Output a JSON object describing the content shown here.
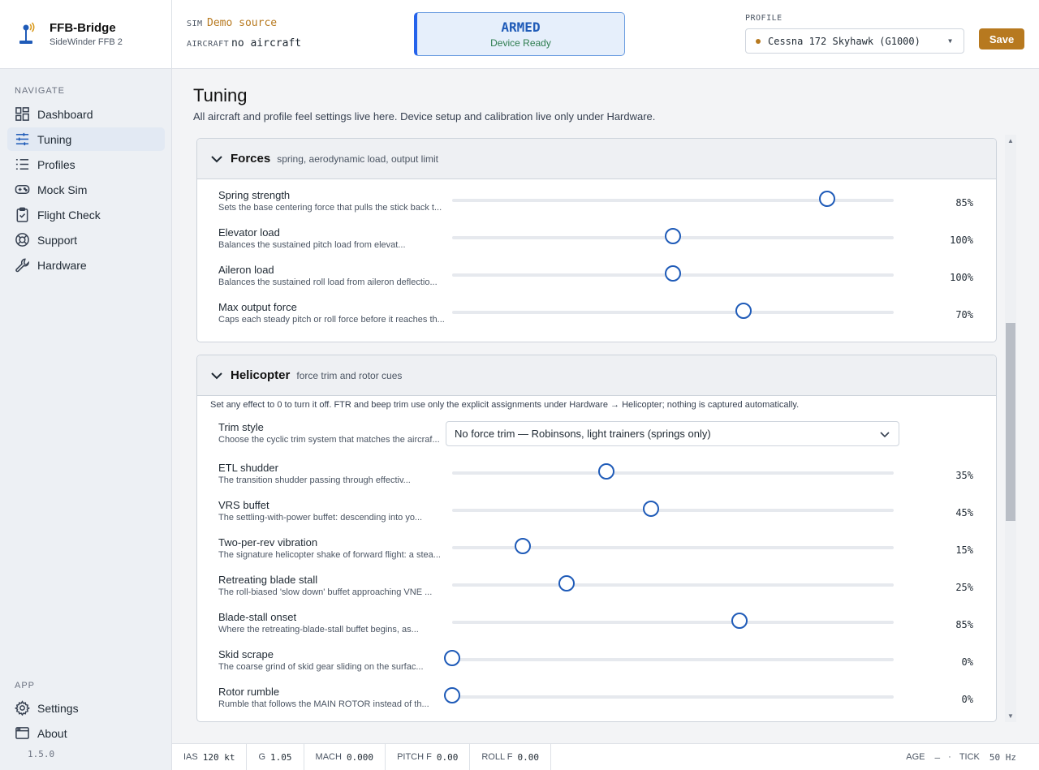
{
  "brand": {
    "title": "FFB-Bridge",
    "subtitle": "SideWinder FFB 2"
  },
  "nav": {
    "heading": "NAVIGATE",
    "items": [
      {
        "label": "Dashboard",
        "icon": "dashboard-icon"
      },
      {
        "label": "Tuning",
        "icon": "sliders-icon",
        "active": true
      },
      {
        "label": "Profiles",
        "icon": "list-icon"
      },
      {
        "label": "Mock Sim",
        "icon": "gamepad-icon"
      },
      {
        "label": "Flight Check",
        "icon": "clipboard-check-icon"
      },
      {
        "label": "Support",
        "icon": "lifebuoy-icon"
      },
      {
        "label": "Hardware",
        "icon": "wrench-icon"
      }
    ],
    "app_heading": "APP",
    "app_items": [
      {
        "label": "Settings",
        "icon": "gear-icon"
      },
      {
        "label": "About",
        "icon": "window-icon"
      }
    ],
    "version": "1.5.0"
  },
  "header": {
    "sim_label": "SIM",
    "sim_value": "Demo source",
    "aircraft_label": "AIRCRAFT",
    "aircraft_value": "no aircraft",
    "status_title": "ARMED",
    "status_sub": "Device Ready",
    "profile_label": "PROFILE",
    "profile_value": "Cessna 172 Skyhawk (G1000)",
    "save_label": "Save"
  },
  "page": {
    "title": "Tuning",
    "subtitle": "All aircraft and profile feel settings live here. Device setup and calibration live only under Hardware."
  },
  "forces": {
    "title": "Forces",
    "desc": "spring, aerodynamic load, output limit",
    "rows": [
      {
        "label": "Spring strength",
        "desc": "Sets the base centering force that pulls the stick back t...",
        "value": 85,
        "display": "85%"
      },
      {
        "label": "Elevator load",
        "desc": "Balances the sustained pitch load from elevat...",
        "value": 50,
        "display": "100%"
      },
      {
        "label": "Aileron load",
        "desc": "Balances the sustained roll load from aileron deflectio...",
        "value": 50,
        "display": "100%"
      },
      {
        "label": "Max output force",
        "desc": "Caps each steady pitch or roll force before it reaches th...",
        "value": 66,
        "display": "70%"
      }
    ]
  },
  "helicopter": {
    "title": "Helicopter",
    "desc": "force trim and rotor cues",
    "note": "Set any effect to 0 to turn it off. FTR and beep trim use only the explicit assignments under Hardware → Helicopter; nothing is captured automatically.",
    "trim": {
      "label": "Trim style",
      "desc": "Choose the cyclic trim system that matches the aircraf...",
      "value": "No force trim — Robinsons, light trainers (springs only)"
    },
    "rows": [
      {
        "label": "ETL shudder",
        "desc": "The transition shudder passing through effectiv...",
        "value": 35,
        "display": "35%"
      },
      {
        "label": "VRS buffet",
        "desc": "The settling-with-power buffet: descending into yo...",
        "value": 45,
        "display": "45%"
      },
      {
        "label": "Two-per-rev vibration",
        "desc": "The signature helicopter shake of forward flight: a stea...",
        "value": 16,
        "display": "15%"
      },
      {
        "label": "Retreating blade stall",
        "desc": "The roll-biased 'slow down' buffet approaching VNE ...",
        "value": 26,
        "display": "25%"
      },
      {
        "label": "Blade-stall onset",
        "desc": "Where the retreating-blade-stall buffet begins, as...",
        "value": 65,
        "display": "85%"
      },
      {
        "label": "Skid scrape",
        "desc": "The coarse grind of skid gear sliding on the surfac...",
        "value": 0,
        "display": "0%"
      },
      {
        "label": "Rotor rumble",
        "desc": "Rumble that follows the MAIN ROTOR instead of th...",
        "value": 0,
        "display": "0%"
      }
    ]
  },
  "status": {
    "items": [
      {
        "k": "IAS",
        "v": "120 kt"
      },
      {
        "k": "G",
        "v": "1.05"
      },
      {
        "k": "MACH",
        "v": "0.000"
      },
      {
        "k": "PITCH F",
        "v": "0.00"
      },
      {
        "k": "ROLL F",
        "v": "0.00"
      }
    ],
    "age_label": "AGE",
    "age_value": "—",
    "sep": "·",
    "tick_label": "TICK",
    "tick_value": "50 Hz"
  },
  "colors": {
    "accent": "#1f5bb8",
    "save": "#b7791f",
    "ready": "#2e7d4f"
  }
}
